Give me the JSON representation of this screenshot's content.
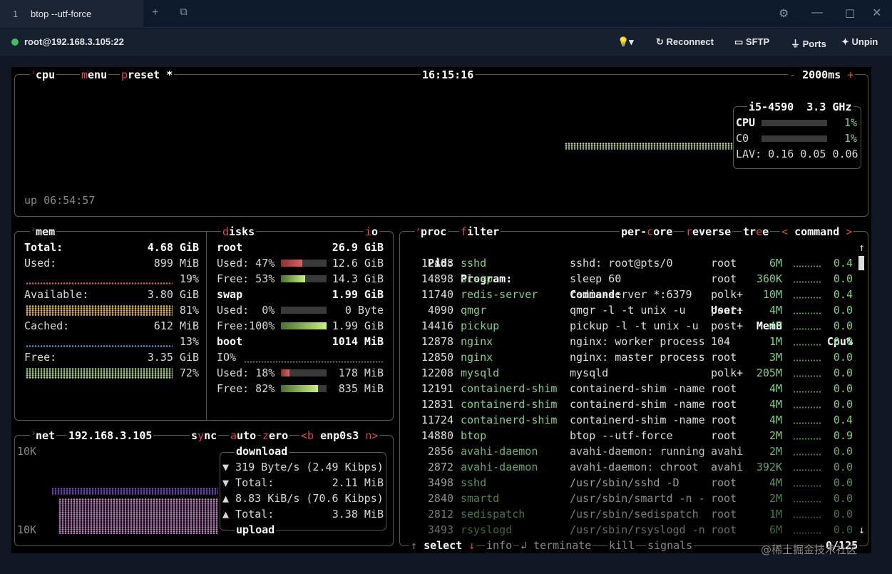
{
  "window": {
    "tab_number": "1",
    "tab_title": "btop --utf-force"
  },
  "toolbar": {
    "host": "root@192.168.3.105:22",
    "reconnect": "Reconnect",
    "sftp": "SFTP",
    "ports": "Ports",
    "unpin": "Unpin"
  },
  "cpu": {
    "label": "cpu",
    "menu": "menu",
    "preset": "preset *",
    "time": "16:15:16",
    "interval": "2000ms",
    "minus": "-",
    "plus": "+",
    "model": "i5-4590",
    "freq": "3.3 GHz",
    "cpu_label": "CPU",
    "cpu_pct": "1%",
    "c0_label": "C0",
    "c0_pct": "1%",
    "lav": "LAV: 0.16 0.05 0.06",
    "uptime": "up 06:54:57",
    "cpu_usage": 0.01
  },
  "mem": {
    "label": "mem",
    "total_label": "Total:",
    "total": "4.68 GiB",
    "used_label": "Used:",
    "used": "899 MiB",
    "used_pct": "19%",
    "available_label": "Available:",
    "available": "3.80 GiB",
    "available_pct": "81%",
    "cached_label": "Cached:",
    "cached": "612 MiB",
    "cached_pct": "13%",
    "free_label": "Free:",
    "free": "3.35 GiB",
    "free_pct": "72%",
    "colors": {
      "used": "#d65a4f",
      "available": "#e8b84a",
      "cached": "#4a8ed6",
      "free": "#a9e06a"
    }
  },
  "disks": {
    "label": "disks",
    "io": "io",
    "root": {
      "name": "root",
      "size": "26.9 GiB",
      "used": "Used: 47%",
      "used_val": "12.6 GiB",
      "free": "Free: 53%",
      "free_val": "14.3 GiB",
      "used_frac": 0.47,
      "free_frac": 0.53
    },
    "swap": {
      "name": "swap",
      "size": "1.99 GiB",
      "used": "Used:  0%",
      "used_val": "0 Byte",
      "free": "Free:100%",
      "free_val": "1.99 GiB",
      "used_frac": 0.0,
      "free_frac": 1.0
    },
    "boot": {
      "name": "boot",
      "size": "1014 MiB",
      "io": "IO%",
      "used": "Used: 18%",
      "used_val": "178 MiB",
      "free": "Free: 82%",
      "free_val": "835 MiB",
      "used_frac": 0.18,
      "free_frac": 0.82
    }
  },
  "net": {
    "label": "net",
    "ip": "192.168.3.105",
    "sync": "sync",
    "auto": "auto",
    "zero": "zero",
    "iface_prev": "<b",
    "iface": "enp0s3",
    "iface_next": "n>",
    "scale_top": "10K",
    "scale_bottom": "10K",
    "download": "download",
    "dl_rate": "▼ 319 Byte/s (2.49 Kibps)",
    "dl_total_label": "▼ Total:",
    "dl_total": "2.11 MiB",
    "ul_rate": "▲ 8.83 KiB/s (70.6 Kibps)",
    "ul_total_label": "▲ Total:",
    "ul_total": "3.38 MiB",
    "upload": "upload"
  },
  "proc": {
    "label": "proc",
    "filter": "filter",
    "per_core": "per-core",
    "reverse": "reverse",
    "tree": "tree",
    "sort_prev": "<",
    "sort": "command",
    "sort_next": ">",
    "headers": {
      "pid": "Pid:",
      "program": "Program:",
      "command": "Command:",
      "user": "User:",
      "mem": "MemB",
      "cpu": "Cpu%"
    },
    "rows": [
      {
        "pid": "12488",
        "program": "sshd",
        "command": "sshd: root@pts/0",
        "user": "root",
        "mem": "6M",
        "cpu": "0.4"
      },
      {
        "pid": "14898",
        "program": "sleep",
        "command": "sleep 60",
        "user": "root",
        "mem": "360K",
        "cpu": "0.0"
      },
      {
        "pid": "11740",
        "program": "redis-server",
        "command": "redis-server *:6379",
        "user": "polk+",
        "mem": "10M",
        "cpu": "0.4"
      },
      {
        "pid": "4090",
        "program": "qmgr",
        "command": "qmgr -l -t unix -u",
        "user": "post+",
        "mem": "4M",
        "cpu": "0.0"
      },
      {
        "pid": "14416",
        "program": "pickup",
        "command": "pickup -l -t unix -u",
        "user": "post+",
        "mem": "4M",
        "cpu": "0.0"
      },
      {
        "pid": "12878",
        "program": "nginx",
        "command": "nginx: worker process",
        "user": "104",
        "mem": "1M",
        "cpu": "0.0"
      },
      {
        "pid": "12850",
        "program": "nginx",
        "command": "nginx: master process",
        "user": "root",
        "mem": "3M",
        "cpu": "0.0"
      },
      {
        "pid": "12208",
        "program": "mysqld",
        "command": "mysqld",
        "user": "polk+",
        "mem": "205M",
        "cpu": "0.0"
      },
      {
        "pid": "12191",
        "program": "containerd-shim",
        "command": "containerd-shim -name",
        "user": "root",
        "mem": "4M",
        "cpu": "0.0"
      },
      {
        "pid": "12831",
        "program": "containerd-shim",
        "command": "containerd-shim -name",
        "user": "root",
        "mem": "4M",
        "cpu": "0.0"
      },
      {
        "pid": "11724",
        "program": "containerd-shim",
        "command": "containerd-shim -name",
        "user": "root",
        "mem": "4M",
        "cpu": "0.4"
      },
      {
        "pid": "14880",
        "program": "btop",
        "command": "btop --utf-force",
        "user": "root",
        "mem": "2M",
        "cpu": "0.9"
      },
      {
        "pid": "2856",
        "program": "avahi-daemon",
        "command": "avahi-daemon: running",
        "user": "avahi",
        "mem": "2M",
        "cpu": "0.0"
      },
      {
        "pid": "2872",
        "program": "avahi-daemon",
        "command": "avahi-daemon: chroot",
        "user": "avahi",
        "mem": "392K",
        "cpu": "0.0"
      },
      {
        "pid": "3498",
        "program": "sshd",
        "command": "/usr/sbin/sshd -D",
        "user": "root",
        "mem": "4M",
        "cpu": "0.0"
      },
      {
        "pid": "2840",
        "program": "smartd",
        "command": "/usr/sbin/smartd -n -",
        "user": "root",
        "mem": "2M",
        "cpu": "0.0"
      },
      {
        "pid": "2812",
        "program": "sedispatch",
        "command": "/usr/sbin/sedispatch",
        "user": "root",
        "mem": "1M",
        "cpu": "0.0"
      },
      {
        "pid": "3493",
        "program": "rsyslogd",
        "command": "/usr/sbin/rsyslogd -n",
        "user": "root",
        "mem": "6M",
        "cpu": "0.0"
      }
    ],
    "footer": {
      "select": "select",
      "info": "info",
      "terminate": "terminate",
      "kill": "kill",
      "signals": "signals",
      "count": "0/125"
    }
  },
  "watermark": "@稀土掘金技术社区"
}
